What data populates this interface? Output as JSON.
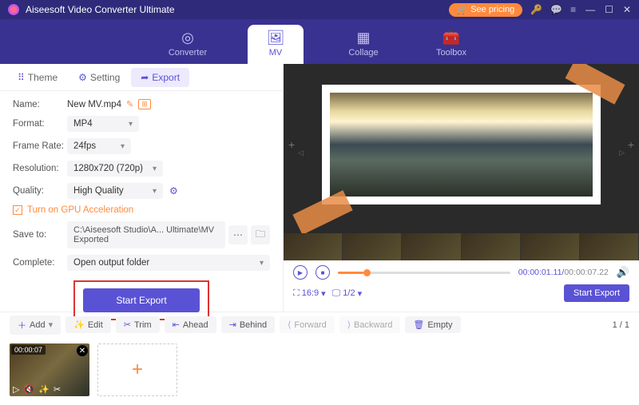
{
  "titlebar": {
    "title": "Aiseesoft Video Converter Ultimate",
    "pricing": "See pricing"
  },
  "topnav": {
    "converter": "Converter",
    "mv": "MV",
    "collage": "Collage",
    "toolbox": "Toolbox"
  },
  "subtabs": {
    "theme": "Theme",
    "setting": "Setting",
    "export": "Export"
  },
  "form": {
    "name_label": "Name:",
    "name_value": "New MV.mp4",
    "format_label": "Format:",
    "format_value": "MP4",
    "framerate_label": "Frame Rate:",
    "framerate_value": "24fps",
    "resolution_label": "Resolution:",
    "resolution_value": "1280x720 (720p)",
    "quality_label": "Quality:",
    "quality_value": "High Quality",
    "gpu_label": "Turn on GPU Acceleration",
    "saveto_label": "Save to:",
    "saveto_value": "C:\\Aiseesoft Studio\\A... Ultimate\\MV Exported",
    "complete_label": "Complete:",
    "complete_value": "Open output folder",
    "start_export": "Start Export"
  },
  "player": {
    "current": "00:00:01.11",
    "duration": "00:00:07.22",
    "aspect": "16:9",
    "page": "1/2",
    "start_export": "Start Export"
  },
  "bottombar": {
    "add": "Add",
    "edit": "Edit",
    "trim": "Trim",
    "ahead": "Ahead",
    "behind": "Behind",
    "forward": "Forward",
    "backward": "Backward",
    "empty": "Empty",
    "pager": "1 / 1"
  },
  "clip": {
    "duration": "00:00:07"
  }
}
